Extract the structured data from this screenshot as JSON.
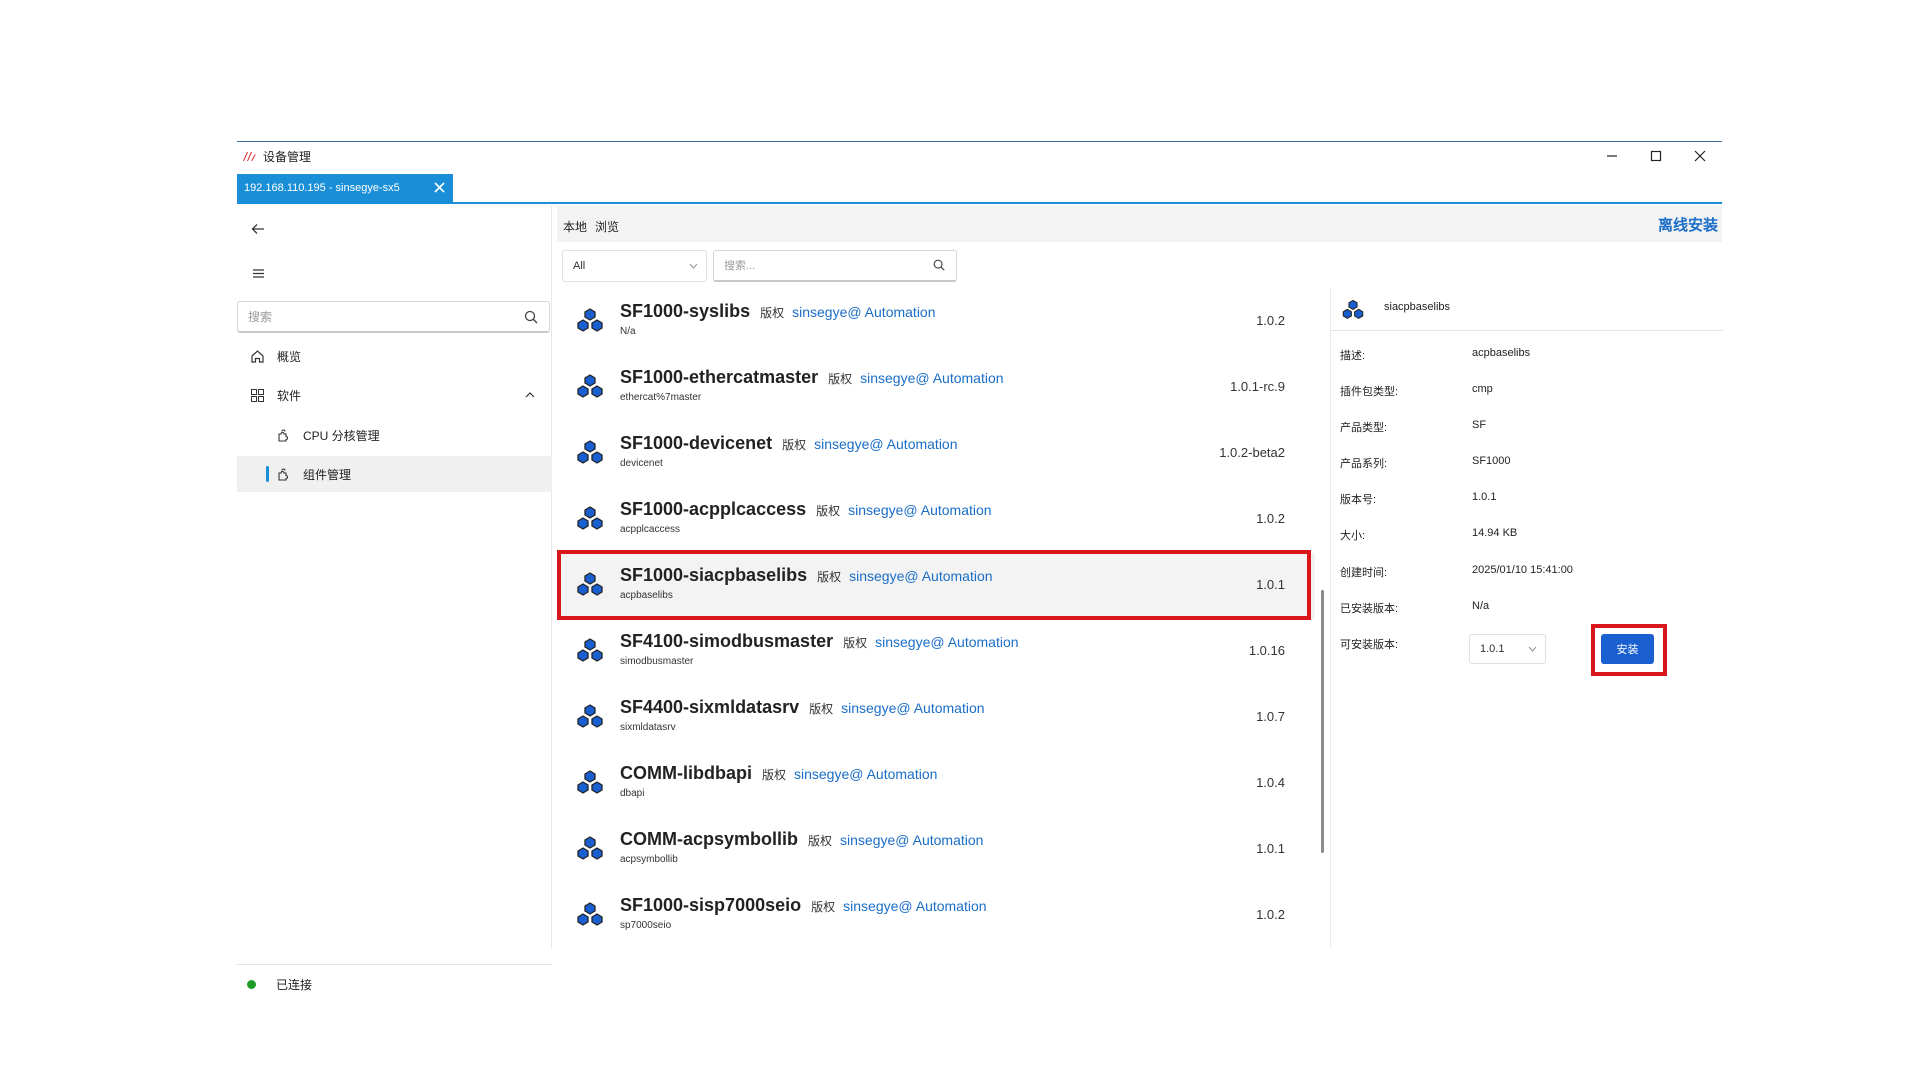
{
  "window": {
    "title": "设备管理"
  },
  "tab": {
    "label": "192.168.110.195 - sinsegye-sx5"
  },
  "sidebar": {
    "search_placeholder": "搜索",
    "items": [
      {
        "label": "概览",
        "icon": "home-icon"
      },
      {
        "label": "软件",
        "icon": "grid-icon"
      },
      {
        "label": "CPU 分核管理",
        "icon": "puzzle-icon"
      },
      {
        "label": "组件管理",
        "icon": "puzzle-icon",
        "selected": true
      }
    ],
    "status": "已连接",
    "status_color": "#1e9a28"
  },
  "main": {
    "tabs": [
      "本地",
      "浏览"
    ],
    "offline_install": "离线安装",
    "filter_value": "All",
    "search_placeholder": "搜索...",
    "tag_label": "版权",
    "vendor": "sinsegye@ Automation",
    "packages": [
      {
        "name": "SF1000-syslibs",
        "sub": "N/a",
        "version": "1.0.2"
      },
      {
        "name": "SF1000-ethercatmaster",
        "sub": "ethercat%7master",
        "version": "1.0.1-rc.9"
      },
      {
        "name": "SF1000-devicenet",
        "sub": "devicenet",
        "version": "1.0.2-beta2"
      },
      {
        "name": "SF1000-acpplcaccess",
        "sub": "acpplcaccess",
        "version": "1.0.2"
      },
      {
        "name": "SF1000-siacpbaselibs",
        "sub": "acpbaselibs",
        "version": "1.0.1",
        "selected": true
      },
      {
        "name": "SF4100-simodbusmaster",
        "sub": "simodbusmaster",
        "version": "1.0.16"
      },
      {
        "name": "SF4400-sixmldatasrv",
        "sub": "sixmldatasrv",
        "version": "1.0.7"
      },
      {
        "name": "COMM-libdbapi",
        "sub": "dbapi",
        "version": "1.0.4"
      },
      {
        "name": "COMM-acpsymbollib",
        "sub": "acpsymbollib",
        "version": "1.0.1"
      },
      {
        "name": "SF1000-sisp7000seio",
        "sub": "sp7000seio",
        "version": "1.0.2"
      }
    ]
  },
  "detail": {
    "title": "siacpbaselibs",
    "props": [
      {
        "k": "描述:",
        "v": "acpbaselibs"
      },
      {
        "k": "插件包类型:",
        "v": "cmp"
      },
      {
        "k": "产品类型:",
        "v": "SF"
      },
      {
        "k": "产品系列:",
        "v": "SF1000"
      },
      {
        "k": "版本号:",
        "v": "1.0.1"
      },
      {
        "k": "大小:",
        "v": "14.94 KB"
      },
      {
        "k": "创建时间:",
        "v": "2025/01/10 15:41:00"
      },
      {
        "k": "已安装版本:",
        "v": "N/a"
      },
      {
        "k": "可安装版本:",
        "v": ""
      }
    ],
    "install_version": "1.0.1",
    "install_label": "安装"
  },
  "colors": {
    "accent": "#1a8fd8",
    "link": "#1a6ec8",
    "highlight": "#d9161c",
    "install": "#1a5fd0"
  }
}
